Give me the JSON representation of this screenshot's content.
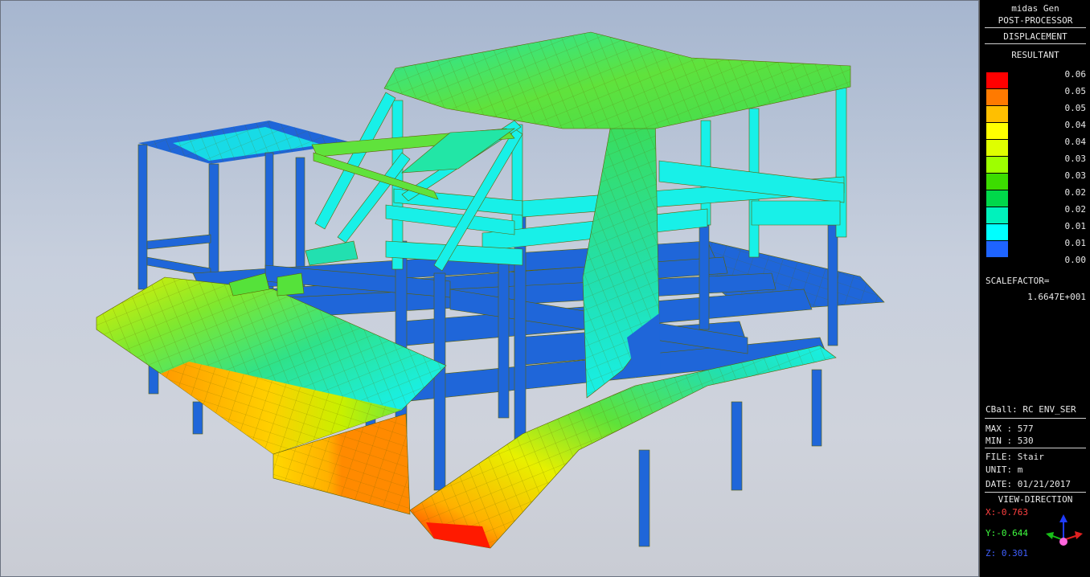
{
  "header": {
    "app": "midas Gen",
    "mode": "POST-PROCESSOR",
    "result_type": "DISPLACEMENT",
    "component": "RESULTANT"
  },
  "legend": {
    "values": [
      "0.06",
      "0.05",
      "0.05",
      "0.04",
      "0.04",
      "0.03",
      "0.03",
      "0.02",
      "0.02",
      "0.01",
      "0.01",
      "0.00"
    ],
    "colors": [
      "#ff0000",
      "#ff7a00",
      "#ffbf00",
      "#ffff00",
      "#dfff00",
      "#9eff00",
      "#3cdc00",
      "#00d84a",
      "#00f2bc",
      "#00ffff",
      "#1e64ff"
    ]
  },
  "scale": {
    "label": "SCALEFACTOR=",
    "value": "1.6647E+001"
  },
  "info": {
    "cball": "CBall: RC ENV_SER",
    "max": "MAX : 577",
    "min": "MIN : 530",
    "file": "FILE: Stair",
    "unit": "UNIT: m",
    "date": "DATE: 01/21/2017"
  },
  "view": {
    "title": "VIEW-DIRECTION",
    "x": "X:-0.763",
    "y": "Y:-0.644",
    "z": "Z: 0.301",
    "axis_colors": {
      "x": "#ff4040",
      "y": "#40ff40",
      "z": "#4060ff"
    }
  },
  "model_colors": {
    "beam": "#1f66d9",
    "beam_dark": "#1552b5",
    "mesh_line": "#6b6b00",
    "cyan": "#18f0e8",
    "aqua": "#22e0b0",
    "green": "#55e23a",
    "yellow": "#f2f000",
    "orange": "#ff9a00",
    "red": "#ff1a00"
  }
}
